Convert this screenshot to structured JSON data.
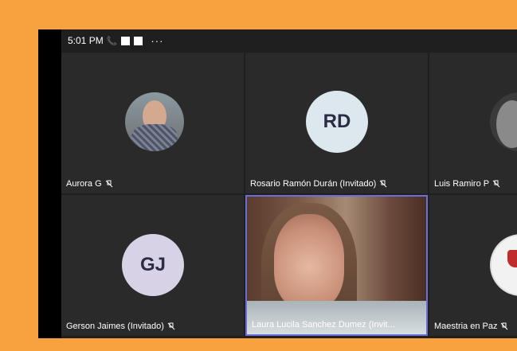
{
  "topbar": {
    "time": "5:01 PM",
    "more": "···"
  },
  "tiles": [
    {
      "name": "Aurora G",
      "avatar_type": "photo"
    },
    {
      "name": "Rosario Ramón Durán (Invitado)",
      "initials": "RD",
      "avatar_color": "#dde7ee"
    },
    {
      "name": "Luis Ramiro P",
      "avatar_type": "photo"
    },
    {
      "name": "Gerson Jaimes (Invitado)",
      "initials": "GJ",
      "avatar_color": "#d7d2e6"
    },
    {
      "name": "Laura Lucila Sanchez Dumez (Invit...",
      "avatar_type": "video",
      "active_speaker": true
    },
    {
      "name": "Maestria en Paz",
      "avatar_type": "logo"
    }
  ],
  "colors": {
    "frame_background": "#f7a23e",
    "tile_background": "#2a2a2a",
    "active_border": "#6b6ed6"
  }
}
